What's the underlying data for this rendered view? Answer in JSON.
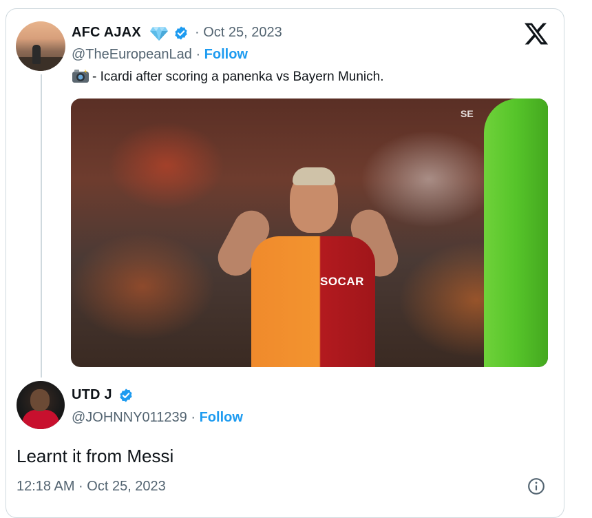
{
  "original_tweet": {
    "author_name": "AFC AJAX",
    "author_handle": "@TheEuropeanLad",
    "separator": "·",
    "date": "Oct 25, 2023",
    "follow_label": "Follow",
    "text": "- Icardi after scoring a panenka vs Bayern Munich.",
    "media_overlay_text": "SOCAR",
    "media_watermark": "SE"
  },
  "reply": {
    "author_name": "UTD J",
    "author_handle": "@JOHNNY011239",
    "separator": "·",
    "follow_label": "Follow",
    "text": "Learnt it from Messi",
    "timestamp": "12:18 AM · Oct 25, 2023"
  },
  "icons": {
    "platform": "x-logo-icon",
    "verified": "verified-badge-icon",
    "diamond": "diamond-emoji-icon",
    "camera": "camera-flash-emoji-icon",
    "info": "info-icon"
  },
  "colors": {
    "accent": "#1d9bf0",
    "text": "#0f1419",
    "muted": "#536471",
    "border": "#cfd9de"
  }
}
